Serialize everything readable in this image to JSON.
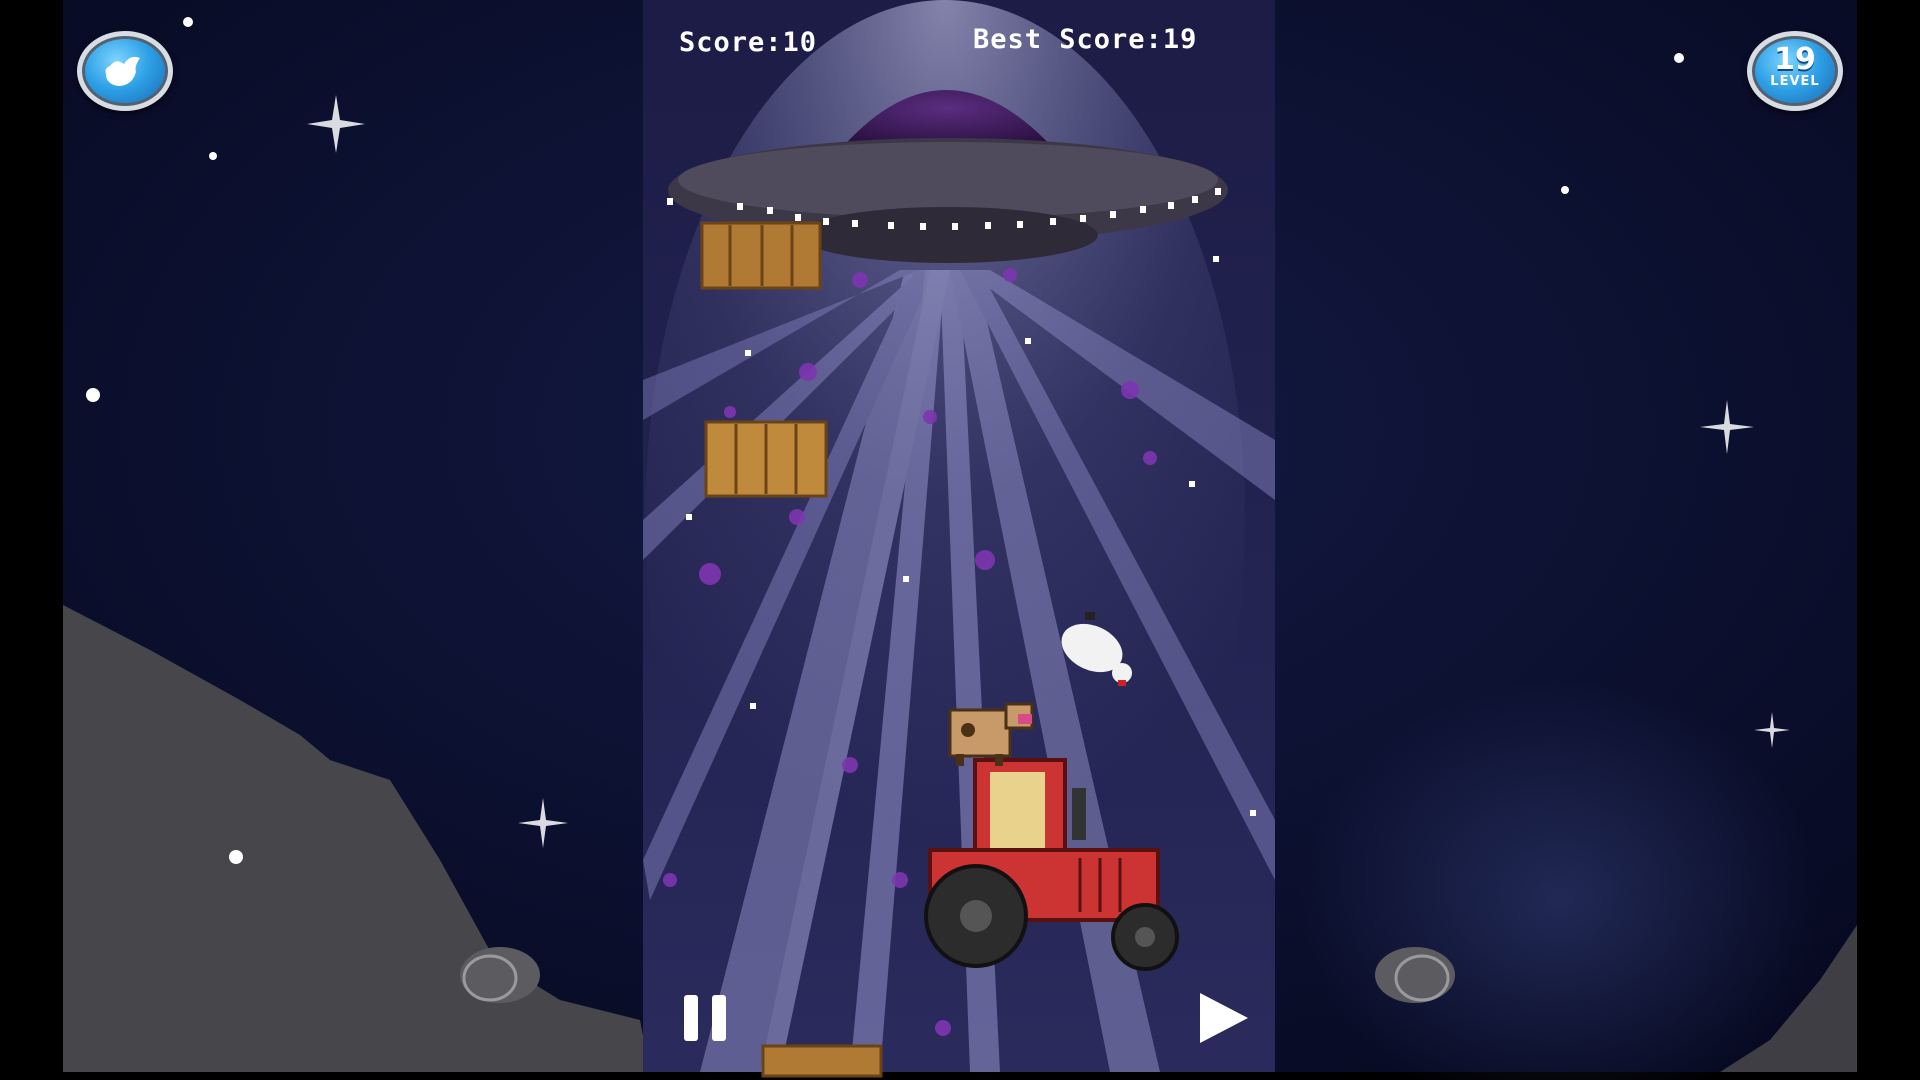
{
  "hud": {
    "score_label": "Score:",
    "score_value": "10",
    "best_label": "Best Score:",
    "best_value": "19"
  },
  "buttons": {
    "share_icon": "bird-icon",
    "level_badge": {
      "number": "19",
      "caption": "LEVEL"
    },
    "pause_icon": "pause-icon",
    "play_icon": "play-icon"
  },
  "colors": {
    "space": "#0b1030",
    "playfield": "#2b2b5e",
    "beam": "#8f8fc4",
    "tractor_red": "#cc3333",
    "hay": "#c8903c",
    "hills": "#4a4a4e"
  }
}
